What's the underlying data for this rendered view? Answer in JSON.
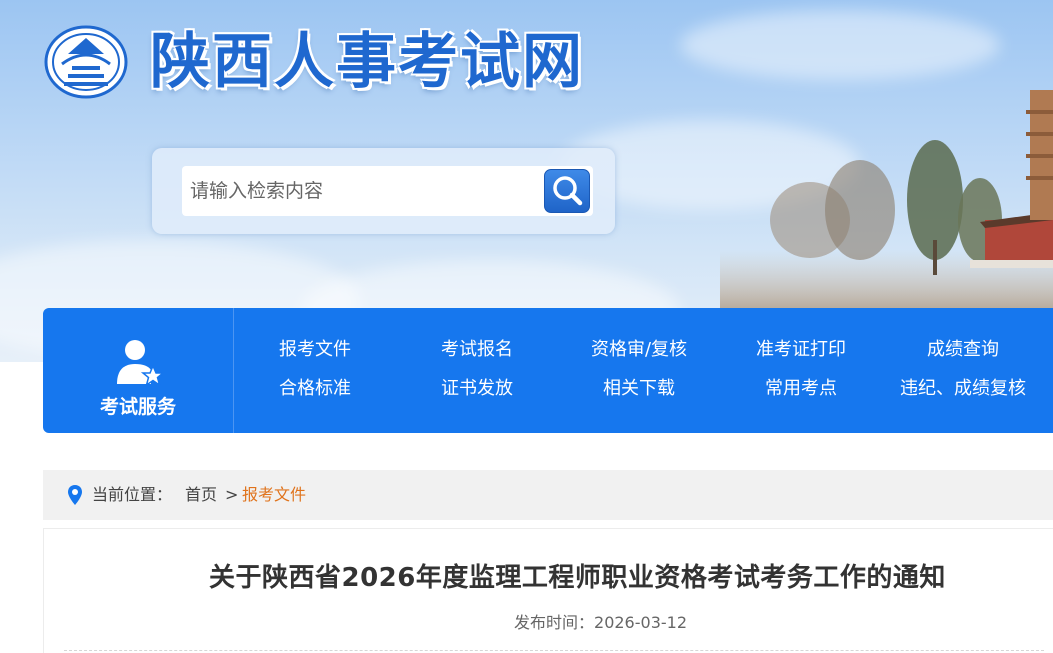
{
  "site": {
    "title": "陕西人事考试网"
  },
  "search": {
    "placeholder": "请输入检索内容"
  },
  "nav": {
    "service_label": "考试服务",
    "links": [
      "报考文件",
      "考试报名",
      "资格审/复核",
      "准考证打印",
      "成绩查询",
      "合格标准",
      "证书发放",
      "相关下载",
      "常用考点",
      "违纪、成绩复核"
    ]
  },
  "breadcrumb": {
    "prefix": "当前位置：",
    "home": "首页",
    "separator": ">",
    "current": "报考文件"
  },
  "article": {
    "title": "关于陕西省2026年度监理工程师职业资格考试考务工作的通知",
    "date_label": "发布时间：",
    "date": "2026-03-12"
  },
  "colors": {
    "brand_blue": "#1677ee",
    "breadcrumb_active": "#e0731c",
    "title_blue": "#1f68cf"
  },
  "icons": {
    "logo": "pagoda-emblem-icon",
    "search": "magnifier-icon",
    "service": "user-star-icon",
    "location": "location-pin-icon"
  }
}
